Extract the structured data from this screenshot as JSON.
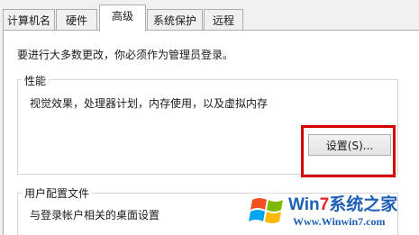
{
  "tabs": [
    {
      "label": "计算机名"
    },
    {
      "label": "硬件"
    },
    {
      "label": "高级"
    },
    {
      "label": "系统保护"
    },
    {
      "label": "远程"
    }
  ],
  "notice": "要进行大多数更改，你必须作为管理员登录。",
  "performance": {
    "title": "性能",
    "description": "视觉效果，处理器计划，内存使用，以及虚拟内存",
    "settings_button": "设置(S)..."
  },
  "user_profiles": {
    "title": "用户配置文件",
    "description": "与登录帐户相关的桌面设置"
  },
  "watermark": {
    "brand_text": "Win7系统之家",
    "url_text": "Www.Winwin7.com",
    "colors": {
      "blue": "#1d5fb4",
      "red": "#e4232a"
    }
  }
}
